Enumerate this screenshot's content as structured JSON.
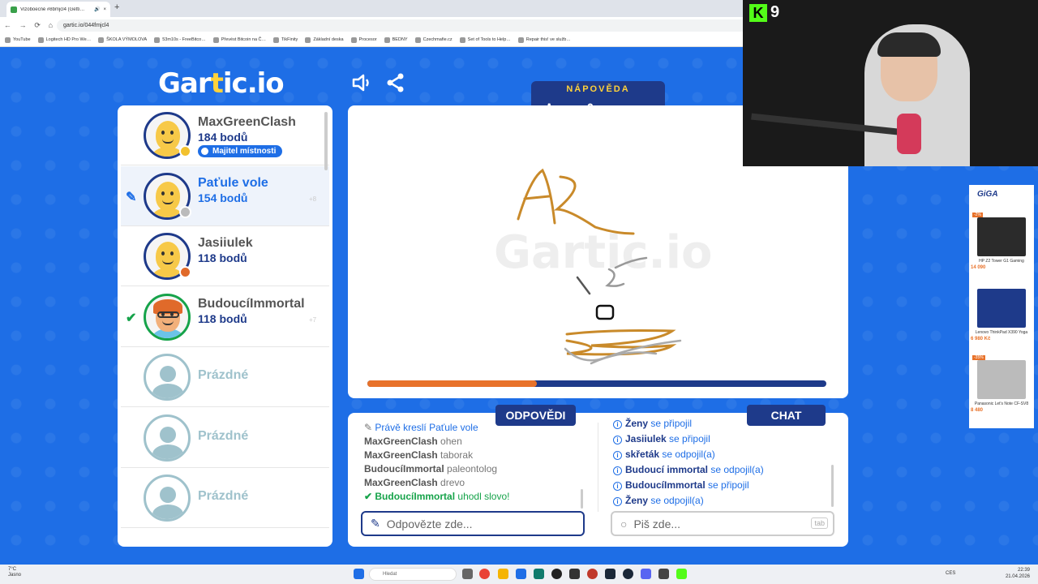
{
  "browser": {
    "tab_title": "Vizoboecné #8bmjcl4 (Getti…",
    "url": "gartic.io/044fmjcl4",
    "bookmarks": [
      "YouTube",
      "Logitech HD Pro We…",
      "ŠKOLA VÝMOLOVA",
      "53m10s - FreeBitco…",
      "Převést Bitcoin na Č…",
      "TikFinity",
      "Základní deska",
      "Procesor",
      "BEDNY",
      "Czechmafie.cz",
      "Set of Tools to Help…",
      "Repair this! ve služb…"
    ]
  },
  "game": {
    "logo": "Gartic.io",
    "hint": {
      "label": "NÁPOVĚDA",
      "letters": "A _ _ O _ _ _ _ _ _"
    },
    "timer_progress": 0.37
  },
  "players": [
    {
      "name": "MaxGreenClash",
      "points": "184 bodů",
      "badge": "Majitel místnosti",
      "status_color": "#f2c12e",
      "avatar": "yellow"
    },
    {
      "name": "Paťule vole",
      "points": "154 bodů",
      "status_color": "#bbbbbb",
      "avatar": "yellow",
      "drawing": true,
      "plus": "+8"
    },
    {
      "name": "Jasiiulek",
      "points": "118 bodů",
      "status_color": "#e06a2a",
      "avatar": "yellow"
    },
    {
      "name": "BudoucíImmortal",
      "points": "118 bodů",
      "status_color": "",
      "avatar": "glasses",
      "guessed": true,
      "plus": "+7"
    },
    {
      "name": "Prázdné",
      "empty": true
    },
    {
      "name": "Prázdné",
      "empty": true
    },
    {
      "name": "Prázdné",
      "empty": true
    }
  ],
  "answers": {
    "tab_label": "ODPOVĚDI",
    "lines": [
      {
        "who": "",
        "text": "Právě kreslí Paťule vole",
        "type": "drawing"
      },
      {
        "who": "MaxGreenClash",
        "text": "ohen",
        "type": "guess"
      },
      {
        "who": "MaxGreenClash",
        "text": "taborak",
        "type": "guess"
      },
      {
        "who": "BudoucíImmortal",
        "text": "paleontolog",
        "type": "guess"
      },
      {
        "who": "MaxGreenClash",
        "text": "drevo",
        "type": "guess"
      },
      {
        "who": "BudoucíImmortal",
        "text": "uhodl slovo!",
        "type": "correct"
      }
    ],
    "placeholder": "Odpovězte zde..."
  },
  "chat": {
    "tab_label": "CHAT",
    "lines": [
      {
        "who": "Ženy",
        "text": "se připojil"
      },
      {
        "who": "Jasiiulek",
        "text": "se připojil"
      },
      {
        "who": "skřeták",
        "text": "se odpojil(a)"
      },
      {
        "who": "Budoucí immortal",
        "text": "se odpojil(a)"
      },
      {
        "who": "BudoucíImmortal",
        "text": "se připojil"
      },
      {
        "who": "Ženy",
        "text": "se odpojil(a)"
      }
    ],
    "placeholder": "Piš zde...",
    "tab_hint": "tab"
  },
  "overlay": {
    "kick_count": "9"
  },
  "ad": {
    "brand": "GiGA",
    "items": [
      {
        "name": "HP Z2 Tower G1 Gaming",
        "price": "14 090",
        "discount": "-2%"
      },
      {
        "name": "Lenovo ThinkPad X390 Yoga",
        "price": "6 980 Kč",
        "discount": ""
      },
      {
        "name": "Panasonic Let's Note CF-SV8",
        "price": "8 480",
        "discount": "-35%"
      }
    ]
  },
  "taskbar": {
    "weather_temp": "7°C",
    "weather_desc": "Jasno",
    "search": "Hledat",
    "lang": "CES",
    "time": "22:39",
    "date": "21.04.2026"
  }
}
